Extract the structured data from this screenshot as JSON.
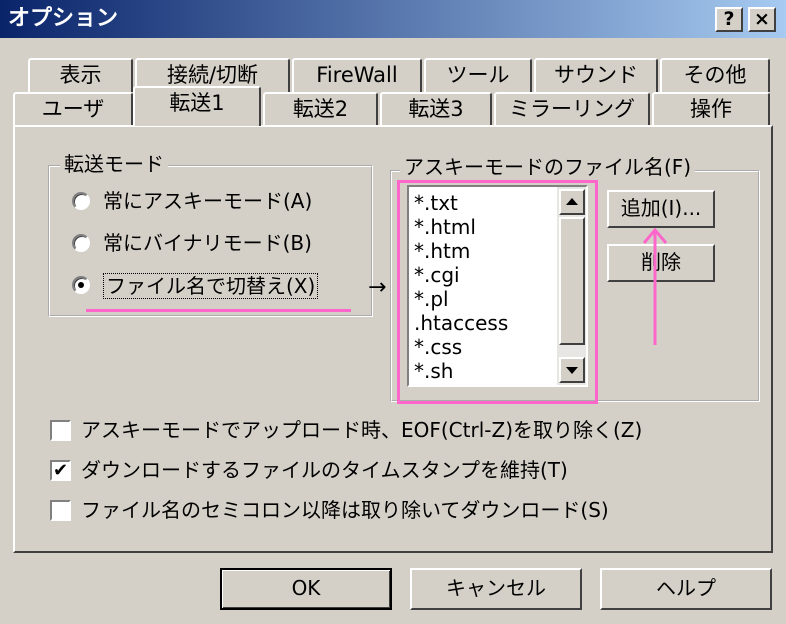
{
  "window": {
    "title": "オプション",
    "help_btn": "?",
    "close_btn": "×"
  },
  "tabs": {
    "row1": [
      "表示",
      "接続/切断",
      "FireWall",
      "ツール",
      "サウンド",
      "その他"
    ],
    "row2": [
      "ユーザ",
      "転送1",
      "転送2",
      "転送3",
      "ミラーリング",
      "操作"
    ],
    "active": "転送1"
  },
  "transfer_mode": {
    "legend": "転送モード",
    "options": [
      "常にアスキーモード(A)",
      "常にバイナリモード(B)",
      "ファイル名で切替え(X)"
    ],
    "selected": 2,
    "arrow": "→"
  },
  "ascii_files": {
    "legend": "アスキーモードのファイル名(F)",
    "items": [
      "*.txt",
      "*.html",
      "*.htm",
      "*.cgi",
      "*.pl",
      ".htaccess",
      "*.css",
      "*.sh"
    ],
    "add_button": "追加(I)...",
    "delete_button": "削除"
  },
  "checkboxes": [
    {
      "label": "アスキーモードでアップロード時、EOF(Ctrl-Z)を取り除く(Z)",
      "checked": false
    },
    {
      "label": "ダウンロードするファイルのタイムスタンプを維持(T)",
      "checked": true
    },
    {
      "label": "ファイル名のセミコロン以降は取り除いてダウンロード(S)",
      "checked": false
    }
  ],
  "buttons": {
    "ok": "OK",
    "cancel": "キャンセル",
    "help": "ヘルプ"
  },
  "colors": {
    "highlight": "#ff66cc",
    "titlebar": "#0a246a",
    "face": "#d4d0c8"
  }
}
